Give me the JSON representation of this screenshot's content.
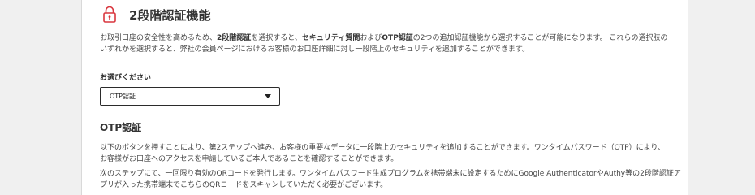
{
  "section": {
    "title": "2段階認証機能",
    "lock_icon": "lock-icon",
    "accent_color": "#d9363e"
  },
  "intro": {
    "part1": "お取引口座の安全性を高めるため、",
    "bold1": "2段階認証",
    "part2": "を選択すると、",
    "bold2": "セキュリティ質問",
    "part3": "および",
    "bold3": "OTP認証",
    "part4": "の2つの追加認証機能から選択することが可能になります。 これらの選択肢の",
    "line2": "いずれかを選択すると、弊社の会員ページにおけるお客様のお口座詳細に対し一段階上のセキュリティを追加することができます。"
  },
  "selector": {
    "label": "お選びください",
    "value": "OTP認証",
    "caret_icon": "caret-down-icon"
  },
  "otp": {
    "heading": "OTP認証",
    "para1_line1": "以下のボタンを押すことにより、第2ステップへ進み、お客様の重要なデータに一段階上のセキュリティを追加することができます。ワンタイムパスワード（OTP）により、",
    "para1_line2": "お客様がお口座へのアクセスを申請しているご本人であることを確認することができます。",
    "para2_line1": "次のステップにて、一回限り有効のQRコードを発行します。ワンタイムパスワード生成プログラムを携帯端末に設定するためにGoogle AuthenticatorやAuthy等の2段階認証ア",
    "para2_line2": "プリが入った携帯端末でこちらのQRコードをスキャンしていただく必要がございます。"
  }
}
